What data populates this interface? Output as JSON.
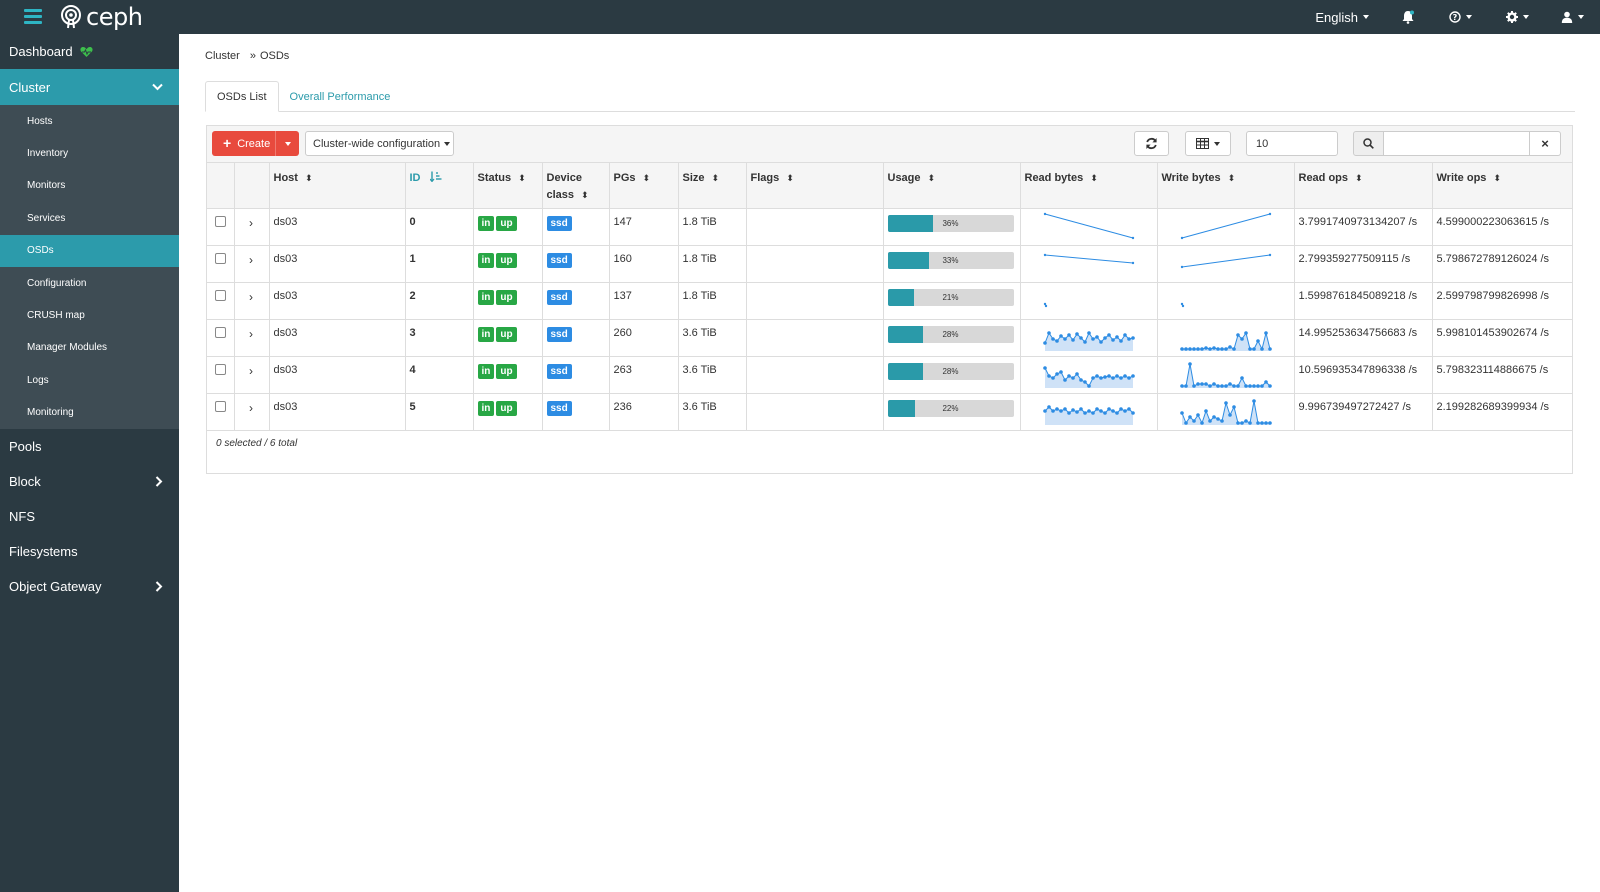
{
  "topbar": {
    "logo_text": "ceph",
    "language": "English"
  },
  "sidebar": {
    "dashboard": "Dashboard",
    "cluster": "Cluster",
    "cluster_items": [
      "Hosts",
      "Inventory",
      "Monitors",
      "Services",
      "OSDs",
      "Configuration",
      "CRUSH map",
      "Manager Modules",
      "Logs",
      "Monitoring"
    ],
    "active_item": "OSDs",
    "pools": "Pools",
    "block": "Block",
    "nfs": "NFS",
    "filesystems": "Filesystems",
    "object_gateway": "Object Gateway"
  },
  "breadcrumb": {
    "parent": "Cluster",
    "current": "OSDs"
  },
  "tabs": [
    {
      "label": "OSDs List",
      "active": true
    },
    {
      "label": "Overall Performance",
      "active": false
    }
  ],
  "toolbar": {
    "create_label": "Create",
    "config_label": "Cluster-wide configuration",
    "limit_value": "10",
    "search_placeholder": ""
  },
  "table": {
    "columns": [
      "Host",
      "ID",
      "Status",
      "Device class",
      "PGs",
      "Size",
      "Flags",
      "Usage",
      "Read bytes",
      "Write bytes",
      "Read ops",
      "Write ops"
    ],
    "rows": [
      {
        "host": "ds03",
        "id": "0",
        "status": [
          "in",
          "up"
        ],
        "device_class": "ssd",
        "pgs": "147",
        "size": "1.8 TiB",
        "flags": "",
        "usage_pct": 36,
        "usage_label": "36%",
        "read_ops": "3.7991740973134207 /s",
        "write_ops": "4.599000223063615 /s"
      },
      {
        "host": "ds03",
        "id": "1",
        "status": [
          "in",
          "up"
        ],
        "device_class": "ssd",
        "pgs": "160",
        "size": "1.8 TiB",
        "flags": "",
        "usage_pct": 33,
        "usage_label": "33%",
        "read_ops": "2.799359277509115 /s",
        "write_ops": "5.798672789126024 /s"
      },
      {
        "host": "ds03",
        "id": "2",
        "status": [
          "in",
          "up"
        ],
        "device_class": "ssd",
        "pgs": "137",
        "size": "1.8 TiB",
        "flags": "",
        "usage_pct": 21,
        "usage_label": "21%",
        "read_ops": "1.5998761845089218 /s",
        "write_ops": "2.599798799826998 /s"
      },
      {
        "host": "ds03",
        "id": "3",
        "status": [
          "in",
          "up"
        ],
        "device_class": "ssd",
        "pgs": "260",
        "size": "3.6 TiB",
        "flags": "",
        "usage_pct": 28,
        "usage_label": "28%",
        "read_ops": "14.995253634756683 /s",
        "write_ops": "5.998101453902674 /s"
      },
      {
        "host": "ds03",
        "id": "4",
        "status": [
          "in",
          "up"
        ],
        "device_class": "ssd",
        "pgs": "263",
        "size": "3.6 TiB",
        "flags": "",
        "usage_pct": 28,
        "usage_label": "28%",
        "read_ops": "10.596935347896338 /s",
        "write_ops": "5.798323114886675 /s"
      },
      {
        "host": "ds03",
        "id": "5",
        "status": [
          "in",
          "up"
        ],
        "device_class": "ssd",
        "pgs": "236",
        "size": "3.6 TiB",
        "flags": "",
        "usage_pct": 22,
        "usage_label": "22%",
        "read_ops": "9.996739497272427 /s",
        "write_ops": "2.199282689399934 /s"
      }
    ]
  },
  "footer_text": "0 selected / 6 total",
  "colors": {
    "accent": "#2c9bab",
    "nav_bg": "#2b3a42",
    "create": "#e84a3d",
    "success": "#28a745",
    "info": "#2d8ce3"
  }
}
